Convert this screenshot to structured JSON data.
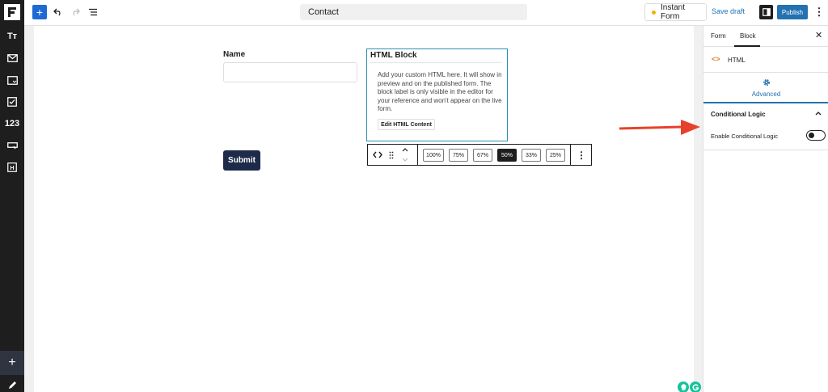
{
  "sidebar_left": {
    "items": [
      {
        "icon": "text-type-icon",
        "label": "Tт"
      },
      {
        "icon": "envelope-icon",
        "label": ""
      },
      {
        "icon": "dropdown-field-icon",
        "label": ""
      },
      {
        "icon": "checkbox-icon",
        "label": ""
      },
      {
        "icon": "number-icon",
        "label": "123"
      },
      {
        "icon": "button-field-icon",
        "label": ""
      },
      {
        "icon": "html-block-icon",
        "label": "H"
      }
    ],
    "bottom_add": "+"
  },
  "toolbar": {
    "add_label": "+",
    "doc_title": "Contact",
    "instant_form_label": "Instant Form",
    "save_draft_label": "Save draft",
    "publish_label": "Publish",
    "more_label": "⋮"
  },
  "form": {
    "name_label": "Name",
    "submit_label": "Submit",
    "html_block": {
      "title": "HTML Block",
      "description": "Add your custom HTML here. It will show in preview and on the published form. The block label is only visible in the editor for your reference and won't appear on the live form.",
      "edit_button_label": "Edit HTML Content"
    },
    "block_toolbar": {
      "widths": [
        "100%",
        "75%",
        "67%",
        "50%",
        "33%",
        "25%"
      ],
      "active_width": "50%",
      "more_label": "⋮"
    }
  },
  "right_panel": {
    "tabs": [
      "Form",
      "Block"
    ],
    "active_tab": "Block",
    "close_label": "✕",
    "block_icon_label": "<>",
    "block_name": "HTML",
    "advanced_label": "Advanced",
    "conditional_logic_title": "Conditional Logic",
    "enable_conditional_label": "Enable Conditional Logic",
    "enable_conditional_value": false
  },
  "colors": {
    "accent": "#2271b1",
    "arrow": "#e8412b",
    "dark": "#1e1e1e"
  }
}
